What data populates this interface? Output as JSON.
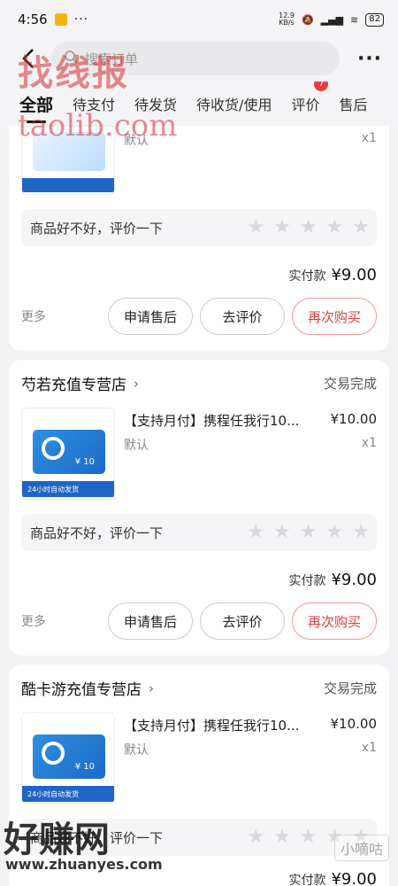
{
  "status_bar": {
    "time": "4:56",
    "net_speed": "12.9",
    "net_unit": "KB/s",
    "battery": "82"
  },
  "header": {
    "search_placeholder": "搜索订单"
  },
  "tabs": [
    {
      "label": "全部",
      "active": true
    },
    {
      "label": "待支付"
    },
    {
      "label": "待发货"
    },
    {
      "label": "待收货/使用"
    },
    {
      "label": "评价",
      "badge": "7"
    },
    {
      "label": "售后"
    }
  ],
  "orders": [
    {
      "product_spec": "默认",
      "quantity": "x1",
      "review_prompt": "商品好不好，评价一下",
      "paid_label": "实付款",
      "paid_amount": "¥9.00",
      "more": "更多",
      "buttons": [
        "申请售后",
        "去评价",
        "再次购买"
      ]
    },
    {
      "shop_name": "芍若充值专营店",
      "status": "交易完成",
      "product_title": "【支持月付】携程任我行10...",
      "product_price": "¥10.00",
      "product_spec": "默认",
      "quantity": "x1",
      "thumb_amount": "¥ 10",
      "thumb_footer": "24小时自动发货",
      "review_prompt": "商品好不好，评价一下",
      "paid_label": "实付款",
      "paid_amount": "¥9.00",
      "more": "更多",
      "buttons": [
        "申请售后",
        "去评价",
        "再次购买"
      ]
    },
    {
      "shop_name": "酷卡游充值专营店",
      "status": "交易完成",
      "product_title": "【支持月付】携程任我行10...",
      "product_price": "¥10.00",
      "product_spec": "默认",
      "quantity": "x1",
      "thumb_amount": "¥ 10",
      "thumb_footer": "24小时自动发货",
      "review_prompt": "商品好不好，评价一下",
      "paid_label": "实付款",
      "paid_amount": "¥9.00"
    }
  ],
  "watermarks": {
    "top": "找线报",
    "top_sub": "taolib.com",
    "bottom": "好赚网",
    "bottom_sub": "www.zhuanyes.com",
    "corner": "小嘀咕"
  },
  "colors": {
    "accent_red": "#e03d3d",
    "badge_red": "#ef3b3b"
  }
}
